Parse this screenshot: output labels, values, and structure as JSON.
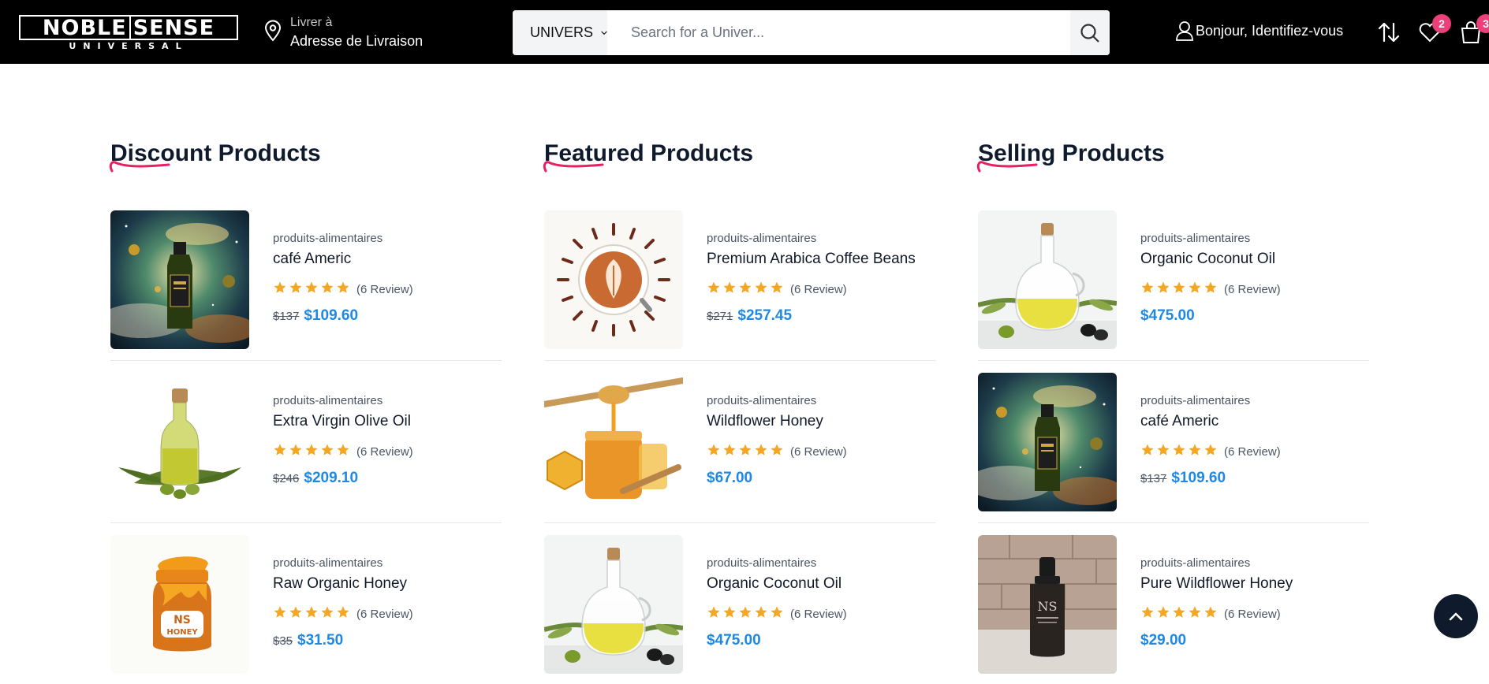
{
  "header": {
    "logo_main_left": "NOBLE",
    "logo_main_right": "SENSE",
    "logo_sub": "UNIVERSAL",
    "deliver_small": "Livrer à",
    "deliver_big": "Adresse de Livraison",
    "search_category": "UNIVERS",
    "search_placeholder": "Search for a Univer...",
    "account_label": "Bonjour, Identifiez-vous",
    "wishlist_count": "2",
    "cart_count": "3"
  },
  "colors": {
    "header_bg": "#000000",
    "price": "#1e88e5",
    "star": "#f5a623",
    "badge": "#ec407a",
    "title": "#0f1b2d",
    "accent_swoosh": "#e91e63"
  },
  "columns": [
    {
      "title": "Discount Products",
      "products": [
        {
          "category": "produits-alimentaires",
          "name": "café Americ",
          "reviews": "(6 Review)",
          "old_price": "$137",
          "price": "$109.60",
          "image": "galaxy-oil-bottle",
          "rating": 5
        },
        {
          "category": "produits-alimentaires",
          "name": "Extra Virgin Olive Oil",
          "reviews": "(6 Review)",
          "old_price": "$246",
          "price": "$209.10",
          "image": "olive-oil-bottle",
          "rating": 5
        },
        {
          "category": "produits-alimentaires",
          "name": "Raw Organic Honey",
          "reviews": "(6 Review)",
          "old_price": "$35",
          "price": "$31.50",
          "image": "ns-honey-jar",
          "rating": 5
        }
      ]
    },
    {
      "title": "Featured Products",
      "products": [
        {
          "category": "produits-alimentaires",
          "name": "Premium Arabica Coffee Beans",
          "reviews": "(6 Review)",
          "old_price": "$271",
          "price": "$257.45",
          "image": "latte-art-cup",
          "rating": 5
        },
        {
          "category": "produits-alimentaires",
          "name": "Wildflower Honey",
          "reviews": "(6 Review)",
          "old_price": "",
          "price": "$67.00",
          "image": "honey-dipper-jar",
          "rating": 5
        },
        {
          "category": "produits-alimentaires",
          "name": "Organic Coconut Oil",
          "reviews": "(6 Review)",
          "old_price": "",
          "price": "$475.00",
          "image": "olive-oil-carafe",
          "rating": 5
        }
      ]
    },
    {
      "title": "Selling Products",
      "products": [
        {
          "category": "produits-alimentaires",
          "name": "Organic Coconut Oil",
          "reviews": "(6 Review)",
          "old_price": "",
          "price": "$475.00",
          "image": "olive-oil-carafe",
          "rating": 5
        },
        {
          "category": "produits-alimentaires",
          "name": "café Americ",
          "reviews": "(6 Review)",
          "old_price": "$137",
          "price": "$109.60",
          "image": "galaxy-oil-bottle",
          "rating": 5
        },
        {
          "category": "produits-alimentaires",
          "name": "Pure Wildflower Honey",
          "reviews": "(6 Review)",
          "old_price": "",
          "price": "$29.00",
          "image": "dropper-bottle",
          "rating": 5
        }
      ]
    }
  ]
}
